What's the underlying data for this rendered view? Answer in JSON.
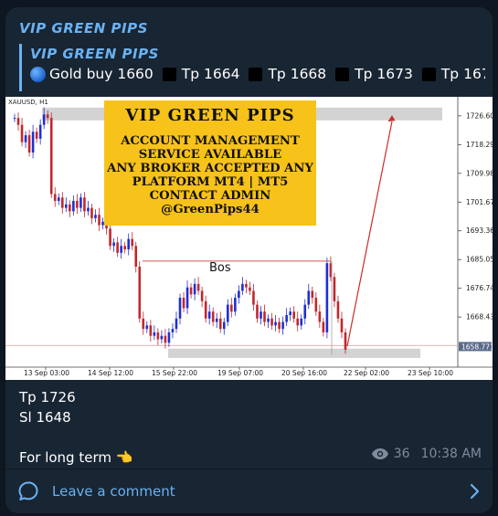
{
  "message": {
    "channel_name": "VIP GREEN PIPS",
    "reply": {
      "title": "VIP GREEN PIPS",
      "segments": [
        "Gold buy 1660",
        "Tp 1664",
        "Tp 1668",
        "Tp 1673",
        "Tp 167..."
      ]
    },
    "body_lines": [
      "Tp 1726",
      "Sl 1648",
      "For long term"
    ],
    "views": "36",
    "time": "10:38 AM"
  },
  "comment_bar": {
    "label": "Leave a comment"
  },
  "image": {
    "symbol": "XAUUSD, H1",
    "ad": {
      "title": "VIP GREEN PIPS",
      "lines": [
        "ACCOUNT MANAGEMENT",
        "SERVICE AVAILABLE",
        "ANY BROKER ACCEPTED ANY",
        "PLATFORM MT4 | MT5",
        "CONTACT ADMIN",
        "@GreenPips44"
      ]
    },
    "bos_label": "Bos",
    "price_levels": [
      {
        "label": "1726.600",
        "value": 1726.6
      },
      {
        "label": "1718.290",
        "value": 1718.29
      },
      {
        "label": "1709.980",
        "value": 1709.98
      },
      {
        "label": "1701.670",
        "value": 1701.67
      },
      {
        "label": "1693.360",
        "value": 1693.36
      },
      {
        "label": "1685.050",
        "value": 1685.05
      },
      {
        "label": "1676.740",
        "value": 1676.74
      },
      {
        "label": "1668.430",
        "value": 1668.43
      }
    ],
    "current_price": "1658.771",
    "time_labels": [
      "13 Sep 03:00",
      "14 Sep 12:00",
      "15 Sep 22:00",
      "19 Sep 07:00",
      "20 Sep 16:00",
      "22 Sep 02:00",
      "23 Sep 10:00"
    ],
    "close_path": [
      1726,
      1724,
      1719,
      1721,
      1716,
      1722,
      1720,
      1724,
      1727,
      1726,
      1704,
      1702,
      1703,
      1700,
      1701,
      1699,
      1702,
      1700,
      1703,
      1699,
      1700,
      1697,
      1698,
      1695,
      1696,
      1694,
      1689,
      1690,
      1687,
      1689,
      1688,
      1691,
      1689,
      1683,
      1668,
      1665,
      1666,
      1663,
      1664,
      1662,
      1663,
      1661,
      1664,
      1665,
      1668,
      1674,
      1671,
      1677,
      1675,
      1678,
      1676,
      1673,
      1668,
      1670,
      1667,
      1668,
      1665,
      1667,
      1672,
      1670,
      1674,
      1676,
      1678,
      1677,
      1676,
      1672,
      1668,
      1670,
      1667,
      1668,
      1666,
      1667,
      1665,
      1667,
      1669,
      1670,
      1668,
      1666,
      1668,
      1672,
      1676,
      1674,
      1670,
      1667,
      1664,
      1684,
      1680,
      1673,
      1668,
      1664,
      1659
    ],
    "colors": {
      "up": "#1f2fd0",
      "down": "#c0282e",
      "ad_bg": "#f7c21a",
      "zone": "#d3d3d3",
      "arrow": "#d02a2a"
    }
  }
}
